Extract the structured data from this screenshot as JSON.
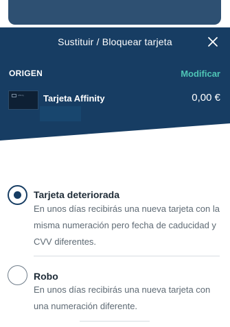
{
  "modal": {
    "title": "Sustituir / Bloquear tarjeta",
    "close_icon": "close-icon"
  },
  "origin": {
    "label": "ORIGEN",
    "modify_label": "Modificar",
    "card_name": "Tarjeta Affinity",
    "card_amount": "0,00 €",
    "card_brand_text": "Affinity"
  },
  "options": [
    {
      "title": "Tarjeta deteriorada",
      "description": "En unos días recibirás una nueva tarjeta con la misma numeración pero fecha de caducidad y CVV diferentes.",
      "selected": true
    },
    {
      "title": "Robo",
      "description": "En unos días recibirás una nueva tarjeta con una numeración diferente.",
      "selected": false
    }
  ],
  "colors": {
    "header_bg": "#173d63",
    "accent": "#4fc5b6",
    "radio_selected": "#173d63"
  }
}
